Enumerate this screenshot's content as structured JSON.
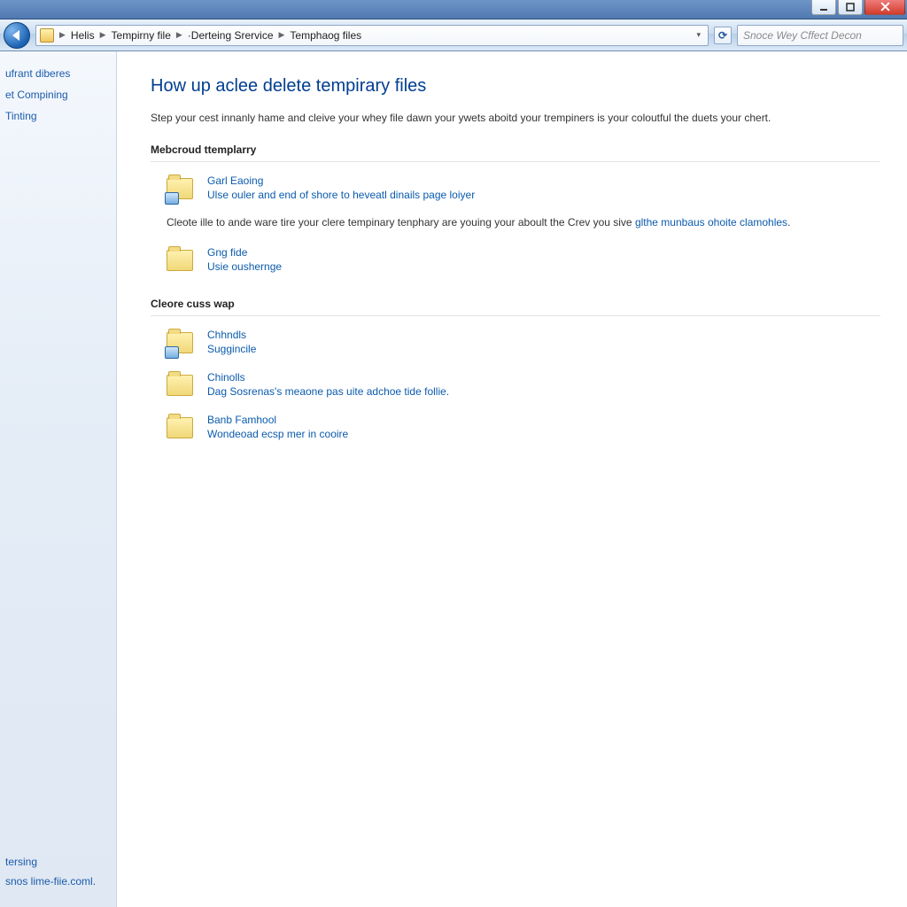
{
  "window": {
    "min_tip": "Minimize",
    "max_tip": "Maximize",
    "close_tip": "Close"
  },
  "address": {
    "crumbs": [
      "Helis",
      "Tempirny file",
      "·Derteing Srervice",
      "Temphaog files"
    ],
    "search_placeholder": "Snoce Wey Cffect Decon"
  },
  "sidebar": {
    "links": [
      "ufrant diberes",
      "et Compining",
      "Tinting"
    ],
    "footer": [
      "tersing",
      "snos lime-fiie.coml."
    ]
  },
  "page": {
    "title": "How up aclee delete tempirary files",
    "intro": "Step your cest innanly hame and cleive your whey file dawn your ywets aboitd your trempiners is your coloutful the duets your chert.",
    "section1": {
      "heading": "Mebcroud ttemplarry",
      "item1": {
        "title": "Garl Eaoing",
        "sub": "Ulse ouler and end of shore to heveatl dinails page loiyer"
      },
      "para_pre": "Cleote ille to ande ware tire your clere tempinary tenphary are youing your aboult the Crev you sive ",
      "para_link": "glthe munbaus ohoite clamohles",
      "para_post": ".",
      "item2": {
        "title": "Gng fide",
        "sub": "Usie oushernge"
      }
    },
    "section2": {
      "heading": "Cleore cuss wap",
      "item1": {
        "title": "Chhndls",
        "sub": "Suggincile"
      },
      "item2": {
        "title": "Chinolls",
        "sub": "Dag Sosrenas's meaone pas uite adchoe tide follie."
      },
      "item3": {
        "title": "Banb Famhool",
        "sub": "Wondeoad ecsp mer in cooire"
      }
    }
  }
}
